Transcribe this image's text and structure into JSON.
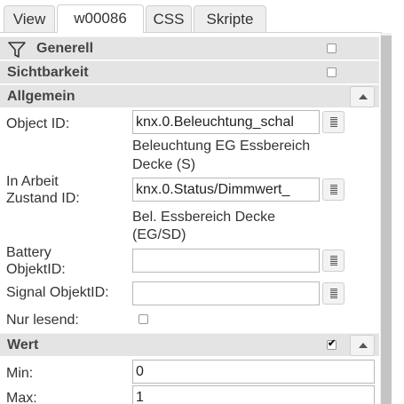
{
  "tabs": [
    "View",
    "w00086",
    "CSS",
    "Skripte"
  ],
  "groups": {
    "generell": "Generell",
    "sichtbarkeit": "Sichtbarkeit",
    "allgemein": "Allgemein",
    "wert": "Wert"
  },
  "fields": {
    "object_id": {
      "label": "Object ID:",
      "value": "knx.0.Beleuchtung_schal",
      "hint_line1": "Beleuchtung EG Essbereich",
      "hint_line2": "Decke (S)"
    },
    "in_arbeit": {
      "label_line1": "In Arbeit",
      "label_line2": "Zustand ID:",
      "value": "knx.0.Status/Dimmwert_",
      "hint_line1": "Bel. Essbereich Decke",
      "hint_line2": "(EG/SD)"
    },
    "battery": {
      "label_line1": "Battery",
      "label_line2": "ObjektID:",
      "value": ""
    },
    "signal": {
      "label": "Signal ObjektID:",
      "value": ""
    },
    "nur_lesend": {
      "label": "Nur lesend:",
      "checked": false
    },
    "min": {
      "label": "Min:",
      "value": "0"
    },
    "max": {
      "label": "Max:",
      "value": "1"
    }
  },
  "wert_checked": true,
  "icons": {
    "filter": "filter-icon",
    "select": "select-object-icon",
    "collapse": "chevron-up-icon"
  }
}
